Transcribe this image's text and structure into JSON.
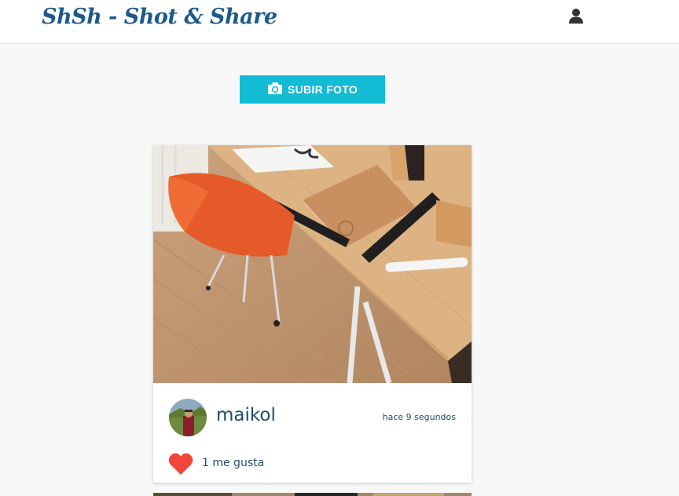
{
  "header": {
    "brand": "ShSh - Shot & Share",
    "user_icon": "user-icon"
  },
  "upload": {
    "label": "SUBIR FOTO",
    "icon": "camera-icon"
  },
  "post": {
    "username": "maikol",
    "timestamp": "hace 9 segundos",
    "likes": "1 me gusta",
    "like_icon": "heart-icon",
    "like_color": "#f2453b"
  },
  "colors": {
    "brand": "#1d5a8a",
    "accent": "#12bcd4",
    "text": "#1f4a70"
  }
}
